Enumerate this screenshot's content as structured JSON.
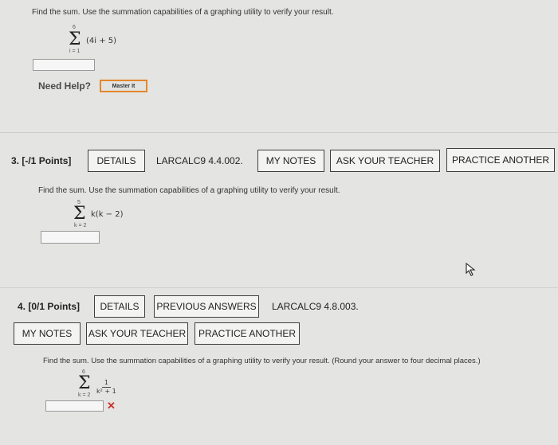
{
  "q2": {
    "prompt": "Find the sum. Use the summation capabilities of a graphing utility to verify your result.",
    "upper": "6",
    "lower": "i = 1",
    "expression": "(4i + 5)",
    "need_help": "Need Help?",
    "master_it": "Master It"
  },
  "q3": {
    "number": "3.",
    "points": "[-/1 Points]",
    "details": "DETAILS",
    "code": "LARCALC9 4.4.002.",
    "my_notes": "MY NOTES",
    "ask_teacher": "ASK YOUR TEACHER",
    "practice": "PRACTICE ANOTHER",
    "prompt": "Find the sum. Use the summation capabilities of a graphing utility to verify your result.",
    "upper": "5",
    "lower": "k = 2",
    "expression": "k(k − 2)"
  },
  "q4": {
    "number": "4.",
    "points": "[0/1 Points]",
    "details": "DETAILS",
    "previous": "PREVIOUS ANSWERS",
    "code": "LARCALC9 4.8.003.",
    "my_notes": "MY NOTES",
    "ask_teacher": "ASK YOUR TEACHER",
    "practice": "PRACTICE ANOTHER",
    "prompt": "Find the sum. Use the summation capabilities of a graphing utility to verify your result. (Round your answer to four decimal places.)",
    "upper": "6",
    "lower": "k = 2",
    "numerator": "1",
    "denominator": "k² + 1",
    "wrong_mark": "✕"
  },
  "colors": {
    "master_border": "#e3872c",
    "wrong": "#c8322a"
  }
}
